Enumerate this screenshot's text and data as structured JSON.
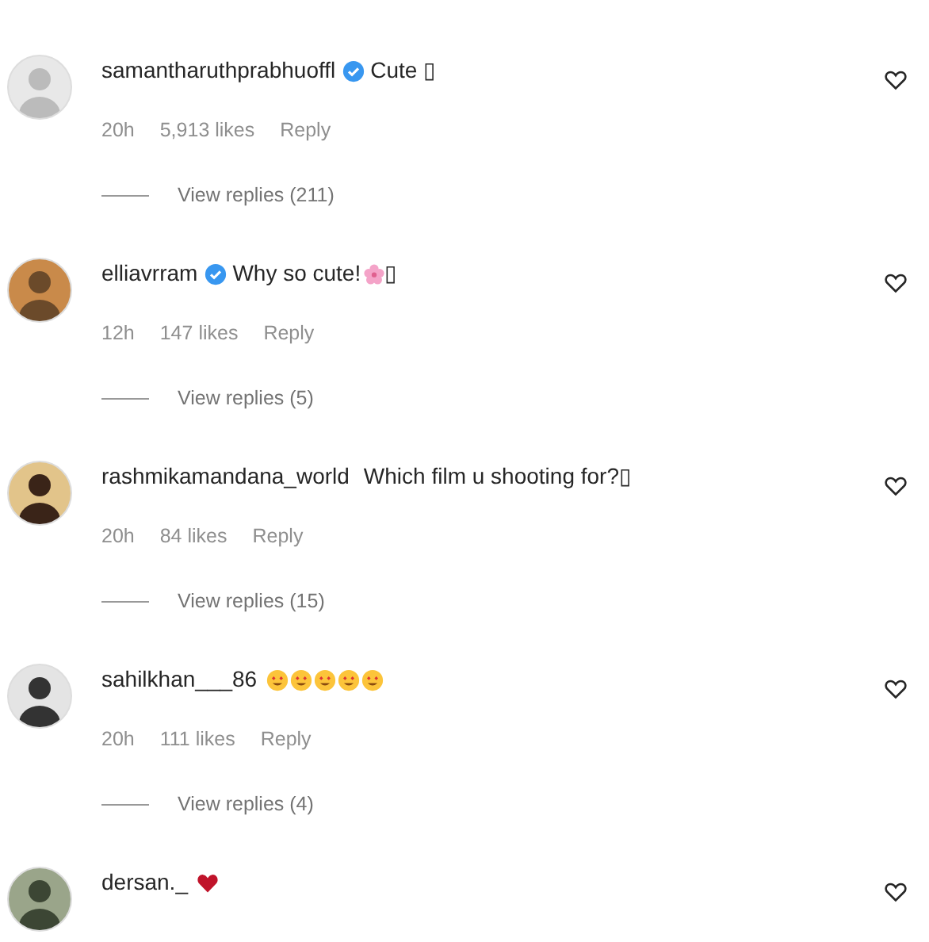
{
  "comments": [
    {
      "username": "samantharuthprabhuoffl",
      "verified": true,
      "text": "Cute ▯",
      "time": "20h",
      "likes": "5,913 likes",
      "reply": "Reply",
      "view_replies": "View replies (211)",
      "liked": false
    },
    {
      "username": "elliavrram",
      "verified": true,
      "text": "Why so cute!",
      "emojis": [
        {
          "kind": "flower"
        }
      ],
      "text_after": "▯",
      "time": "12h",
      "likes": "147 likes",
      "reply": "Reply",
      "view_replies": "View replies (5)",
      "liked": false
    },
    {
      "username": "rashmikamandana_world",
      "verified": false,
      "text": "Which film u shooting for?▯",
      "time": "20h",
      "likes": "84 likes",
      "reply": "Reply",
      "view_replies": "View replies (15)",
      "liked": false
    },
    {
      "username": "sahilkhan___86",
      "verified": false,
      "emojis": [
        {
          "kind": "smiley"
        },
        {
          "kind": "smiley"
        },
        {
          "kind": "smiley"
        },
        {
          "kind": "smiley"
        },
        {
          "kind": "smiley"
        }
      ],
      "time": "20h",
      "likes": "111 likes",
      "reply": "Reply",
      "view_replies": "View replies (4)",
      "liked": false
    },
    {
      "username": "dersan._",
      "verified": false,
      "emojis": [
        {
          "kind": "heart"
        }
      ],
      "liked": false
    }
  ]
}
